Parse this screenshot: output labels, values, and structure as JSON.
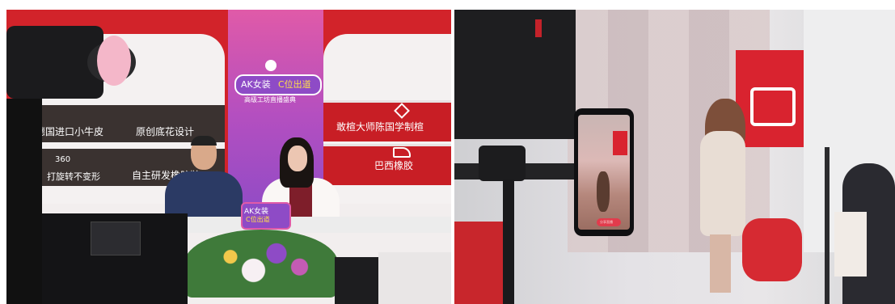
{
  "left_photo": {
    "stage_sign": {
      "title_line1": "AK女装",
      "title_line2": "C位出道",
      "subtitle": "高级工坊直播盛典"
    },
    "wall_panels_dark": {
      "row1_left": "德国进口小牛皮",
      "row1_right": "原创底花设计",
      "row2_left": "360",
      "row2_left_sub": "打旋转不变形",
      "row2_right": "自主研发橡胶鞋"
    },
    "wall_panels_red": {
      "row1": "敢楦大师陈国学制楦",
      "row2": "巴西橡胶"
    },
    "desk_sign": {
      "line1": "AK女装",
      "line2": "C位出道"
    }
  },
  "right_photo": {
    "phone_screen_button": "分享直播"
  },
  "colors": {
    "wall_red": "#d2232a",
    "panel_dark": "#3a3230",
    "sign_pink": "#e05aa8",
    "sign_purple": "#8e4bc6"
  }
}
